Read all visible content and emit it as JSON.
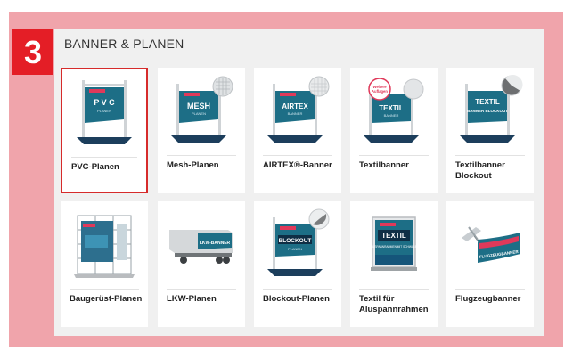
{
  "step_number": "3",
  "section_title": "BANNER & PLANEN",
  "products": [
    {
      "label": "PVC-Planen",
      "banner_text": "P V C",
      "banner_sub": "PLANEN"
    },
    {
      "label": "Mesh-Planen",
      "banner_text": "MESH",
      "banner_sub": "PLANEN"
    },
    {
      "label": "AIRTEX®-Banner",
      "banner_text": "AIRTEX",
      "banner_sub": "BANNER"
    },
    {
      "label": "Textilbanner",
      "banner_text": "TEXTIL",
      "banner_sub": "BANNER",
      "badge": "Weitere Auflagen"
    },
    {
      "label": "Textilbanner Blockout",
      "banner_text": "TEXTIL",
      "banner_sub": "BANNER BLOCKOUT"
    },
    {
      "label": "Baugerüst-Planen"
    },
    {
      "label": "LKW-Planen",
      "banner_text": "LKW-BANNER"
    },
    {
      "label": "Blockout-Planen",
      "banner_text": "BLOCKOUT",
      "banner_sub": "PLANEN"
    },
    {
      "label": "Textil für Aluspannrahmen",
      "banner_text": "TEXTIL",
      "banner_sub": "ALUSPANNRAHMEN MIT SCHWALBE"
    },
    {
      "label": "Flugzeugbanner",
      "banner_text": "FLUGZEUGBANNER"
    }
  ],
  "colors": {
    "accent_red": "#e41e26",
    "frame_pink": "#f0a4ab",
    "banner_teal": "#1d6e86",
    "banner_navy": "#1c3e5c"
  }
}
